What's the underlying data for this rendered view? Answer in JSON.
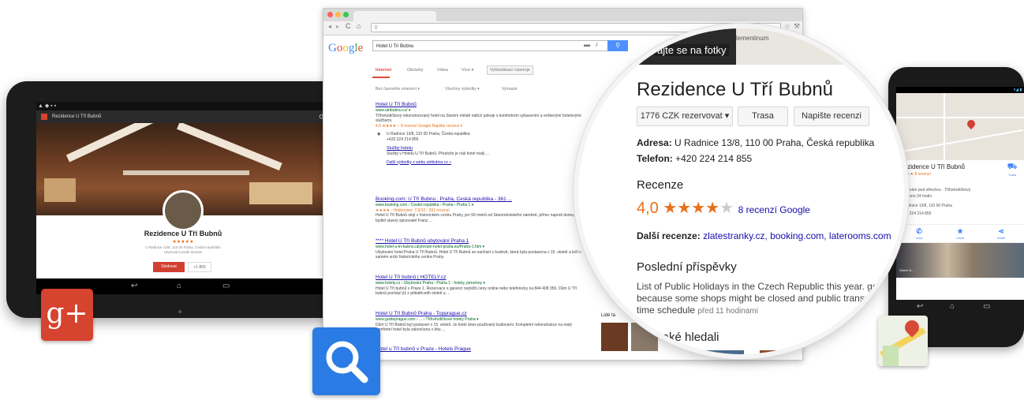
{
  "tablet": {
    "tab_title": "Rezidence U Tří Bubnů",
    "place_name": "Rezidence U Tří Bubnů",
    "stars": "★★★★★",
    "address_lines": [
      "U Radnice 13/8, 110 00 Praha, Česká republika",
      "Ubytování podle desetin"
    ],
    "primary_button": "Sledovat",
    "secondary_button": "+1 855"
  },
  "google_plus_icon": "g+",
  "browser": {
    "query": "Hotel U Tri Bubnu",
    "logo": "Google",
    "nav": [
      "Internet",
      "Obrázky",
      "Videa",
      "Více ▾",
      "Vyhledávací nástroje"
    ],
    "filters": [
      "Bez časového omezení ▾",
      "Všechny výsledky ▾",
      "Vymazat"
    ],
    "results": [
      {
        "title": "Hotel U Tří Bubnů",
        "url": "www.utribubnu.cz/ ▾",
        "snippet": "Třihvězdičkový rekonstruovaný hotel na Starém městě nabízí pokoje s komfortním vybavením a veškerými hotelovými službami.",
        "rating": "4,0 ★★★★☆ 8 recenzí Google   Napište recenzi ▾",
        "address": "U Radnice 13/8, 110 00 Praha, Česká republika",
        "phone": "+420 224 214 855",
        "sitelink": "Služby hotelu",
        "sitelink_desc": "Služby v Hotelu U Tří Bubnů. Přestože je náš hotel malý ...",
        "more": "Další výsledky z webu utribubnu.cz »"
      },
      {
        "title": "Booking.com: U Tří Bubnu , Praha, Česká republika - 361 ...",
        "url": "www.booking.com › Česká republika › Praha › Praha 1 ▾",
        "rating": "★★★★ - Hodnocení: 7,6/10 - 361 recenzí",
        "snippet": "Hotel U Tří Bubnů stojí v historickém centru Prahy, jen 50 metrů od Staroměstského náměstí, přímo naproti domu, kde bydlel slavný spisovatel Franz ..."
      },
      {
        "title": "**** Hotel U Tří Bubnů ubytování Praha 1",
        "url": "www.hotel-u-tri-bubnu.ubytovani-hotel-praha.eu/Praha-1.htm ▾",
        "snippet": "Ubytování hotel Praha U Tří Bubnů. Hotel U Tří Bubnů se nachází v budově, která byla postavena v 15. století a leží v samém srdci historického centra Prahy."
      },
      {
        "title": "Hotel U Tří bubnů | HOTELY.cz",
        "url": "www.hotely.cz › Ubytování Praha › Praha 1 - hotely, penziony ▾",
        "snippet": "Hotel U Tří bubnů v Praze 1. Rezervace s garancí nejnižší ceny online nebo telefonicky na 844 408 359. Dům U Tří bubnů pochází již z pětiatřicetih století a ..."
      },
      {
        "title": "Hotel U Tří Bubnů Praha - Topprague.cz",
        "url": "www.guideprague.com › ... › Tříhvězdičkové hotely Praha ▾",
        "snippet": "Dům U Tří Bubnů byl postaven v 15. století. Je hotel dnes použivaný budovami. Kompletní rekonstrukce na malý komfortní hotel byla zakončena v létu ..."
      },
      {
        "title": "Hotel u Tří bubnů v Praze - Hotels Prague",
        "url": "",
        "snippet": ""
      }
    ],
    "side_label": "Lidé ta"
  },
  "magnifier": {
    "photo_label": "ajte se na fotky",
    "map_label": "lementinum",
    "title": "Rezidence U Tří Bubnů",
    "buttons": [
      "1776 CZK rezervovat ▾",
      "Trasa",
      "Napište recenzi"
    ],
    "address_label": "Adresa:",
    "address": "U Radnice 13/8, 110 00 Praha, Česká republika",
    "phone_label": "Telefon:",
    "phone": "+420 224 214 855",
    "reviews_heading": "Recenze",
    "rating_value": "4,0",
    "rating_value_num": 4.0,
    "rating_stars": "★★★★",
    "rating_empty": "★",
    "reviews_link": "8 recenzí Google",
    "other_reviews_label": "Další recenze:",
    "other_reviews": "zlatestranky.cz, booking.com, laterooms.com",
    "posts_heading": "Poslední příspěvky",
    "post_line1": "List of Public Holidays in the Czech Republic this year. good",
    "post_line2": "because some shops might be closed and public transport",
    "post_line3": "time schedule",
    "post_time": "před 11 hodinami",
    "also_searched": "é také hledali"
  },
  "phone": {
    "place_name": "Rezidence U Tří Bubnů",
    "rating_snippet": "★★★★ 8 recenzí",
    "route_label": "Trasa",
    "line1": "Ubytování pod střechou · Třihvězdičkový",
    "line2": "Otevřeno 24 hodin",
    "line3": "U Radnice 13/8, 110 00 Praha",
    "line4": "+420 224 214 855",
    "actions": [
      {
        "icon": "✆",
        "label": "Volat"
      },
      {
        "icon": "★",
        "label": "Uložit"
      },
      {
        "icon": "⋖",
        "label": "Sdílet"
      }
    ],
    "street_label": "Street Vi..."
  }
}
